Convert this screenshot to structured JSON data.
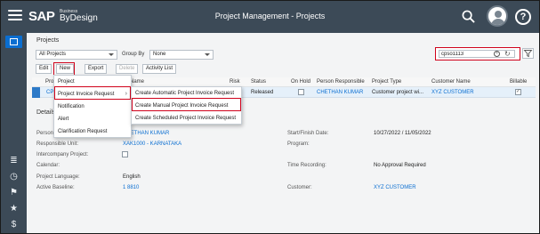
{
  "shell": {
    "brand_sap": "SAP",
    "brand_small": "Business",
    "brand_name": "ByDesign",
    "title": "Project Management - Projects",
    "icons": [
      "menu-icon",
      "search-icon",
      "user-avatar-icon",
      "help-icon"
    ]
  },
  "left_nav": {
    "icons": [
      "workcenter-icon",
      "list-icon",
      "clock-icon",
      "flag-icon",
      "star-icon",
      "dollar-icon"
    ]
  },
  "section_title": "Projects",
  "filters": {
    "view_value": "All Projects",
    "group_by_label": "Group By",
    "group_by_value": "None",
    "search_value": "cpso1113"
  },
  "toolbar": {
    "edit": "Edit",
    "new": "New",
    "export": "Export",
    "delete": "Delete",
    "activity_list": "Activity List"
  },
  "table": {
    "headers": {
      "project": "Project",
      "name": "Name",
      "risk": "Risk",
      "status": "Status",
      "on_hold": "On Hold",
      "person_responsible": "Person Responsible",
      "project_type": "Project Type",
      "customer_name": "Customer Name",
      "billable": "Billable"
    },
    "row": {
      "project": "CPS",
      "status": "Released",
      "person_responsible": "CHETHAN KUMAR",
      "project_type": "Customer project wi...",
      "customer_name": "XYZ CUSTOMER"
    }
  },
  "details": {
    "title": "Details",
    "person_label": "Person",
    "person_value": "CHETHAN KUMAR",
    "responsible_unit_label": "Responsible Unit:",
    "responsible_unit_value": "XAK1000 - KARNATAKA",
    "intercompany_label": "Intercompany Project:",
    "calendar_label": "Calendar:",
    "language_label": "Project Language:",
    "language_value": "English",
    "baseline_label": "Active Baseline:",
    "baseline_value": "1 8810",
    "dates_label": "Start/Finish Date:",
    "dates_value": "10/27/2022 / 11/05/2022",
    "program_label": "Program:",
    "time_recording_label": "Time Recording:",
    "time_recording_value": "No Approval Required",
    "customer_label": "Customer:",
    "customer_value": "XYZ CUSTOMER"
  },
  "new_menu": {
    "items": [
      "Project",
      "Project Invoice Request",
      "Notification",
      "Alert",
      "Clarification Request"
    ]
  },
  "submenu": {
    "items": [
      "Create Automatic Project Invoice Request",
      "Create Manual Project Invoice Request",
      "Create Scheduled Project Invoice Request"
    ]
  },
  "colors": {
    "shell_bg": "#3c4a57",
    "accent": "#0a6ed1",
    "highlight": "#d0021b",
    "row_selected": "#e5f0fa"
  }
}
